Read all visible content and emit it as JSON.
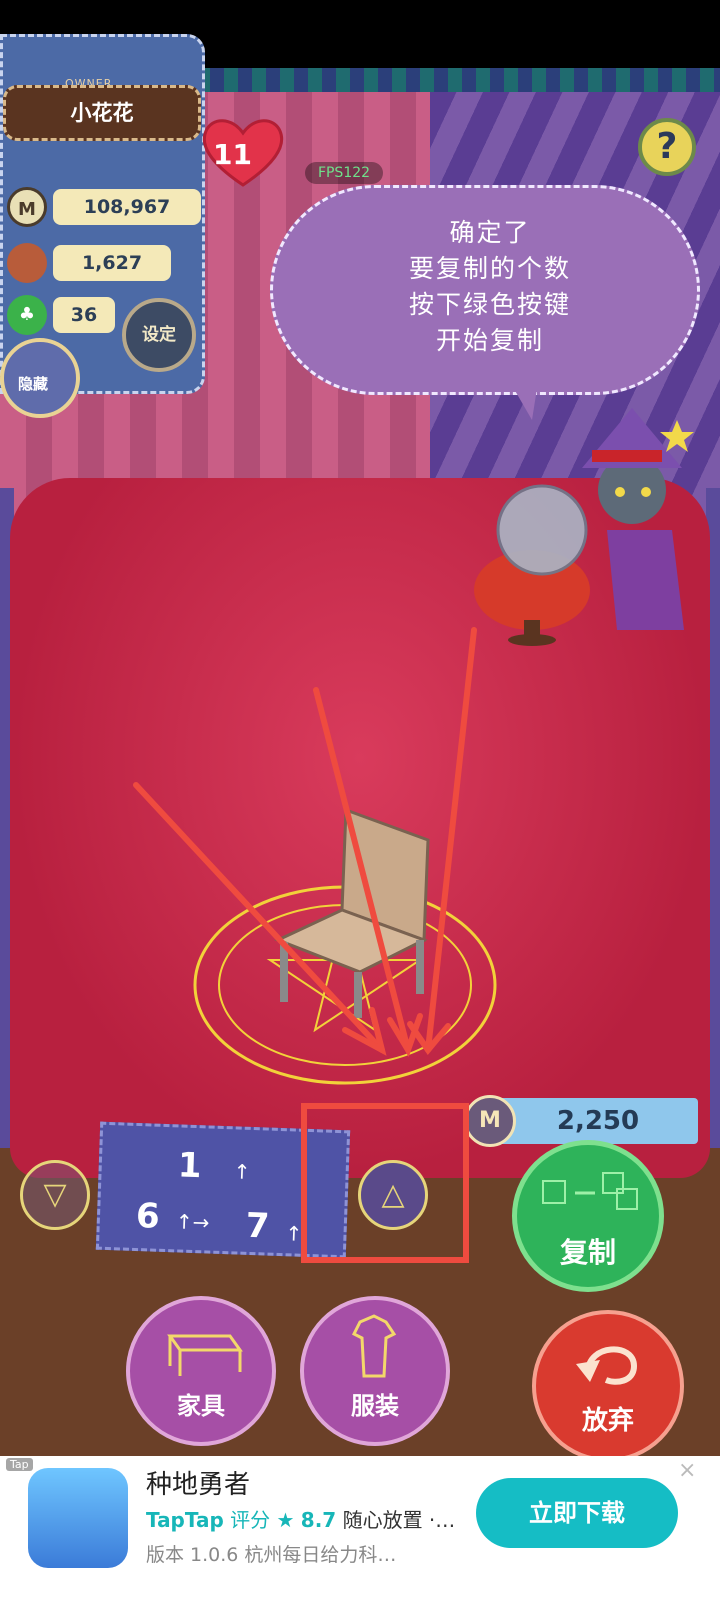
{
  "owner": {
    "tag": "OWNER",
    "name": "小花花",
    "level": "11"
  },
  "stats": {
    "coins": "108,967",
    "materials": "1,627",
    "clover": "36",
    "coin_symbol": "M"
  },
  "buttons": {
    "settings": "设定",
    "hide": "隐藏",
    "help": "?",
    "copy": "复制",
    "furniture": "家具",
    "clothes": "服装",
    "abandon": "放弃"
  },
  "fps": "FPS122",
  "speech": {
    "lines": [
      "确定了",
      "要复制的个数",
      "按下绿色按键",
      "开始复制"
    ]
  },
  "copy": {
    "price": "2,250",
    "count_top": "1",
    "count_left": "6",
    "count_right": "7"
  },
  "ad": {
    "tag": "Tap",
    "title": "种地勇者",
    "taptap": "TapTap",
    "rating_label": "评分",
    "rating": "8.7",
    "desc": "随心放置 ·…",
    "version_line": "版本 1.0.6  杭州每日给力科…",
    "download": "立即下载",
    "close": "×"
  },
  "colors": {
    "accent_green": "#2eb35a",
    "accent_red": "#d93a2f",
    "annotation_red": "#ef4b3f",
    "ad_teal": "#15bdc5"
  }
}
